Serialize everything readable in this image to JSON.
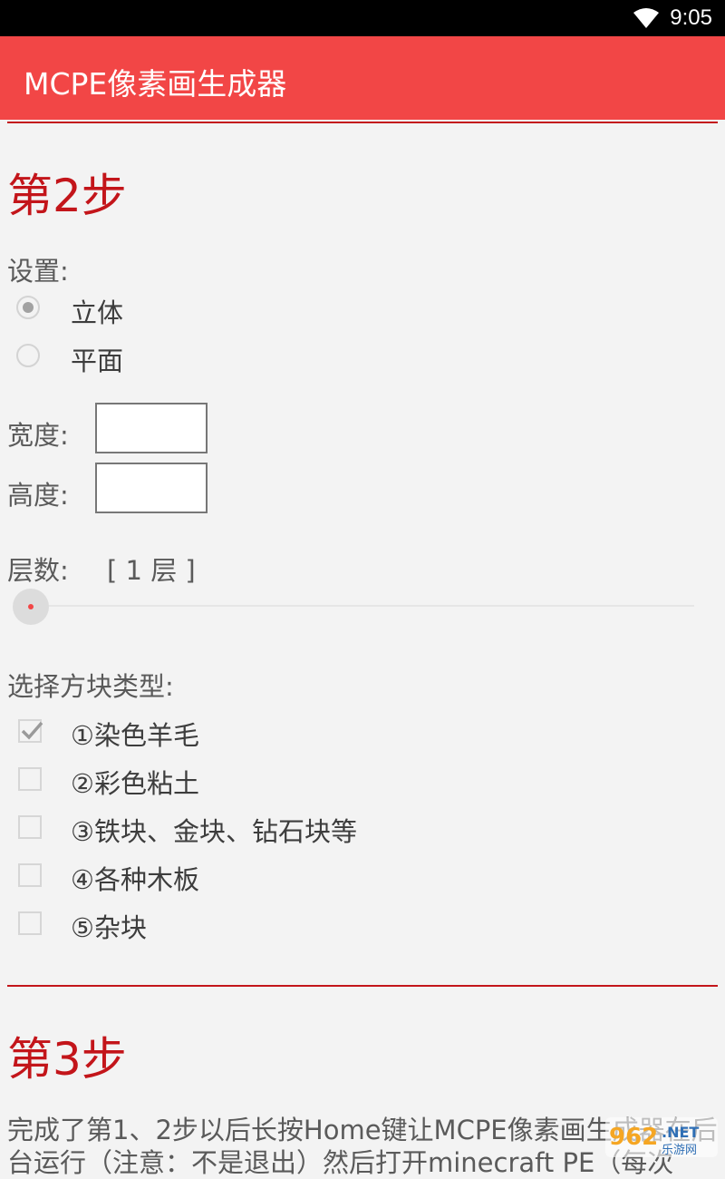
{
  "status_bar": {
    "time": "9:05",
    "wifi_icon": "wifi-icon"
  },
  "app_bar": {
    "title": "MCPE像素画生成器"
  },
  "step2": {
    "title": "第2步",
    "settings_label": "设置:",
    "mode_options": [
      {
        "label": "立体",
        "selected": true
      },
      {
        "label": "平面",
        "selected": false
      }
    ],
    "width_label": "宽度:",
    "width_value": "",
    "height_label": "高度:",
    "height_value": "",
    "layers_label": "层数:",
    "layers_value": "[ 1 层 ]",
    "block_type_label": "选择方块类型:",
    "block_types": [
      {
        "label": "①染色羊毛",
        "checked": true
      },
      {
        "label": "②彩色粘土",
        "checked": false
      },
      {
        "label": "③铁块、金块、钻石块等",
        "checked": false
      },
      {
        "label": "④各种木板",
        "checked": false
      },
      {
        "label": "⑤杂块",
        "checked": false
      }
    ]
  },
  "step3": {
    "title": "第3步",
    "description": "完成了第1、2步以后长按Home键让MCPE像素画生成器在后台运行（注意：不是退出）然后打开minecraft PE（每次"
  },
  "watermark": {
    "text": "962.NET",
    "subtext": "乐游网"
  },
  "colors": {
    "accent": "#f24646",
    "step_title": "#c3151a",
    "background": "#f3f3f3"
  }
}
